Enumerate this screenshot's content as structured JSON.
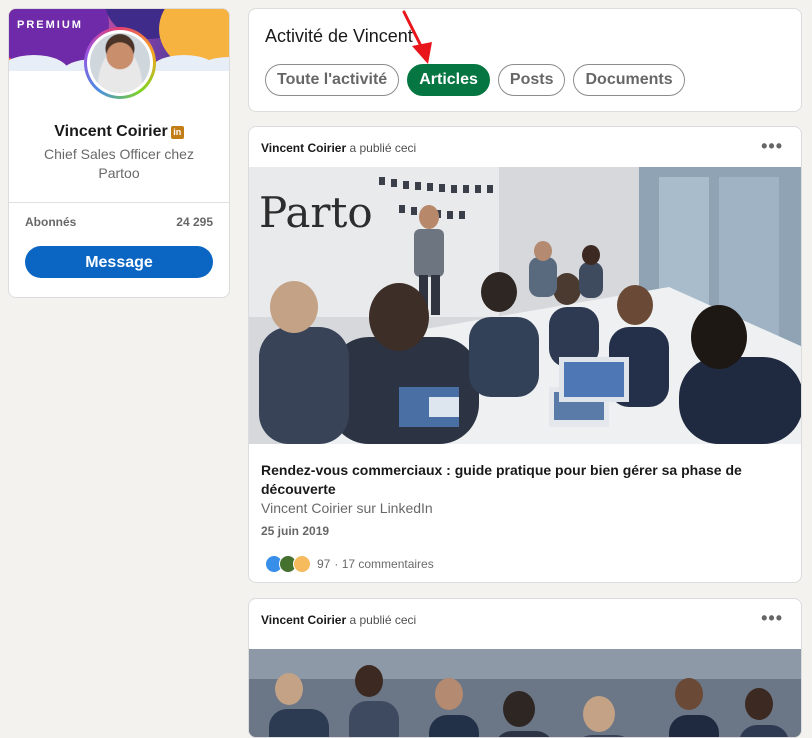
{
  "profile": {
    "banner_label": "PREMIUM",
    "name": "Vincent Coirier",
    "badge": "in",
    "headline": "Chief Sales Officer chez Partoo",
    "followers_label": "Abonnés",
    "followers_count": "24 295",
    "message_label": "Message"
  },
  "activity": {
    "title": "Activité de Vincent",
    "filters": [
      {
        "label": "Toute l'activité",
        "active": false
      },
      {
        "label": "Articles",
        "active": true
      },
      {
        "label": "Posts",
        "active": false
      },
      {
        "label": "Documents",
        "active": false
      }
    ]
  },
  "posts": [
    {
      "author": "Vincent Coirier",
      "action": "a publié ceci",
      "more": "•••",
      "article_title": "Rendez-vous commerciaux : guide pratique pour bien gérer sa phase de découverte",
      "article_source": "Vincent Coirier sur LinkedIn",
      "date": "25 juin 2019",
      "reaction_count": "97",
      "comments": "· 17 commentaires",
      "reaction_icons": [
        "like-icon",
        "celebrate-icon",
        "insightful-icon"
      ]
    },
    {
      "author": "Vincent Coirier",
      "action": "a publié ceci",
      "more": "•••"
    }
  ],
  "colors": {
    "accent_active": "#057642",
    "primary_button": "#0a66c2",
    "annotation_arrow": "#e8151b"
  }
}
